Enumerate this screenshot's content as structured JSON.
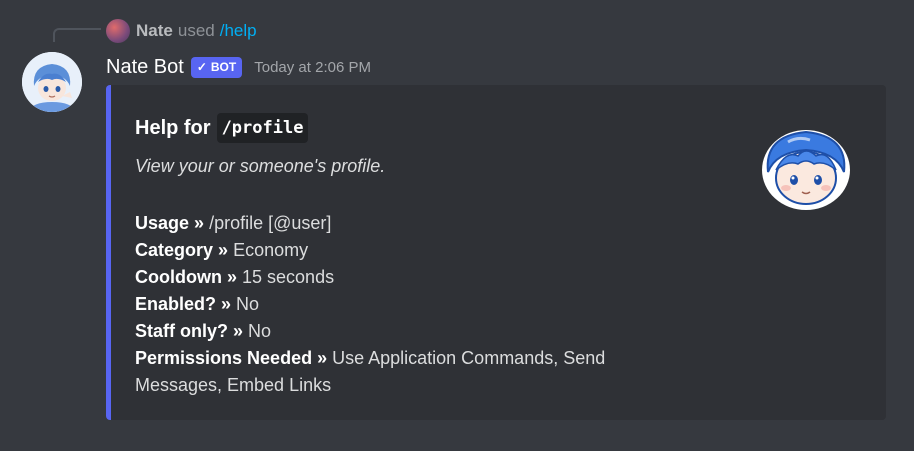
{
  "interaction": {
    "user": "Nate",
    "used_text": "used",
    "command": "/help"
  },
  "message": {
    "author": "Nate Bot",
    "bot_tag": "BOT",
    "timestamp": "Today at 2:06 PM"
  },
  "embed": {
    "title_prefix": "Help for",
    "title_command": "/profile",
    "description": "View your or someone's profile.",
    "accent_color": "#5865f2",
    "fields": [
      {
        "name": "Usage »",
        "value": "/profile [@user]"
      },
      {
        "name": "Category »",
        "value": "Economy"
      },
      {
        "name": "Cooldown »",
        "value": "15 seconds"
      },
      {
        "name": "Enabled? »",
        "value": "No"
      },
      {
        "name": "Staff only? »",
        "value": "No"
      },
      {
        "name": "Permissions Needed »",
        "value": "Use Application Commands, Send Messages, Embed Links"
      }
    ]
  },
  "colors": {
    "background": "#36393f",
    "embed_background": "#2f3136",
    "link": "#00aff4"
  }
}
